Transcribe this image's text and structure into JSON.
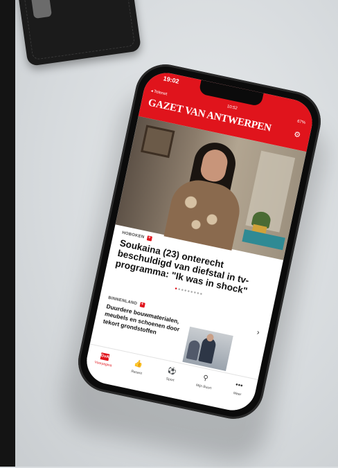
{
  "phone": {
    "outer_time": "19:02",
    "status": {
      "carrier": "◂ Telenet",
      "time": "10:52",
      "battery": "67%"
    }
  },
  "app": {
    "brand": "GAZET VAN ANTWERPEN",
    "accent": "#e0141c",
    "settings_icon": "gear-icon"
  },
  "featured": {
    "section": "HOBOKEN",
    "headline": "Soukaina (23) onterecht beschuldigd van diefstal in tv-programma: \"Ik was in shock\""
  },
  "secondary": {
    "section": "BINNENLAND",
    "headline": "Duurdere bouwmaterialen, meubels en schoenen door tekort grondstoffen"
  },
  "tabs": [
    {
      "label": "Voorpagina",
      "icon": "gva-logo-icon"
    },
    {
      "label": "Recent",
      "icon": "thumbs-icon"
    },
    {
      "label": "Sport",
      "icon": "football-icon"
    },
    {
      "label": "Mijn Buurt",
      "icon": "location-icon"
    },
    {
      "label": "Meer",
      "icon": "more-icon"
    }
  ]
}
